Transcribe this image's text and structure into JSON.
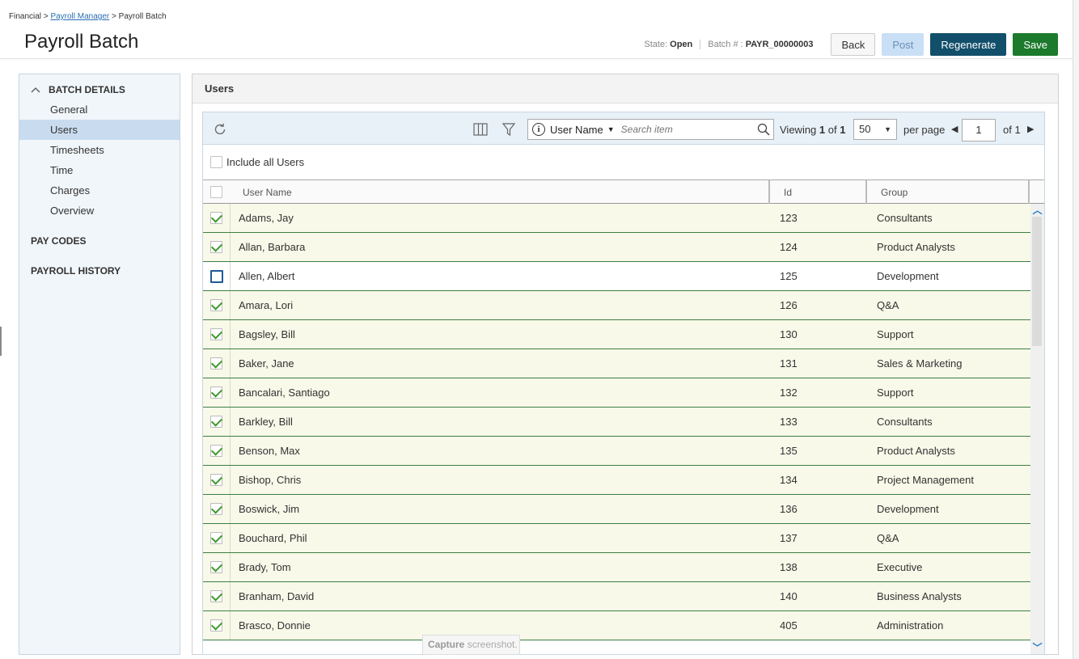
{
  "breadcrumb": {
    "root": "Financial",
    "sep1": ">",
    "parent": "Payroll Manager",
    "sep2": ">",
    "current": "Payroll Batch"
  },
  "page": {
    "title": "Payroll Batch"
  },
  "header": {
    "state_label": "State:",
    "state_value": "Open",
    "batch_label": "Batch # :",
    "batch_value": "PAYR_00000003",
    "back": "Back",
    "post": "Post",
    "regenerate": "Regenerate",
    "save": "Save"
  },
  "sidebar": {
    "batch_details": "BATCH DETAILS",
    "items": [
      {
        "label": "General"
      },
      {
        "label": "Users"
      },
      {
        "label": "Timesheets"
      },
      {
        "label": "Time"
      },
      {
        "label": "Charges"
      },
      {
        "label": "Overview"
      }
    ],
    "pay_codes": "PAY CODES",
    "payroll_history": "PAYROLL HISTORY"
  },
  "panel": {
    "title": "Users"
  },
  "toolbar": {
    "search_field": "User Name",
    "search_placeholder": "Search item",
    "viewing_label": "Viewing",
    "viewing_from": "1",
    "viewing_of": "of",
    "viewing_total": "1",
    "per_page_value": "50",
    "per_page_label": "per page",
    "page_value": "1",
    "page_of": "of 1"
  },
  "include_all": "Include all Users",
  "columns": {
    "user": "User Name",
    "id": "Id",
    "group": "Group"
  },
  "users": [
    {
      "name": "Adams, Jay",
      "id": "123",
      "group": "Consultants",
      "checked": true
    },
    {
      "name": "Allan, Barbara",
      "id": "124",
      "group": "Product Analysts",
      "checked": true
    },
    {
      "name": "Allen, Albert",
      "id": "125",
      "group": "Development",
      "checked": false
    },
    {
      "name": "Amara, Lori",
      "id": "126",
      "group": "Q&A",
      "checked": true
    },
    {
      "name": "Bagsley, Bill",
      "id": "130",
      "group": "Support",
      "checked": true
    },
    {
      "name": "Baker, Jane",
      "id": "131",
      "group": "Sales & Marketing",
      "checked": true
    },
    {
      "name": "Bancalari, Santiago",
      "id": "132",
      "group": "Support",
      "checked": true
    },
    {
      "name": "Barkley, Bill",
      "id": "133",
      "group": "Consultants",
      "checked": true
    },
    {
      "name": "Benson, Max",
      "id": "135",
      "group": "Product Analysts",
      "checked": true
    },
    {
      "name": "Bishop, Chris",
      "id": "134",
      "group": "Project Management",
      "checked": true
    },
    {
      "name": "Boswick, Jim",
      "id": "136",
      "group": "Development",
      "checked": true
    },
    {
      "name": "Bouchard, Phil",
      "id": "137",
      "group": "Q&A",
      "checked": true
    },
    {
      "name": "Brady, Tom",
      "id": "138",
      "group": "Executive",
      "checked": true
    },
    {
      "name": "Branham, David",
      "id": "140",
      "group": "Business Analysts",
      "checked": true
    },
    {
      "name": "Brasco, Donnie",
      "id": "405",
      "group": "Administration",
      "checked": true
    }
  ],
  "tooltip": {
    "bold": "Capture",
    "rest": "screenshot."
  },
  "icons": {
    "refresh": "refresh-icon",
    "columns": "columns-icon",
    "filter": "filter-icon",
    "info": "info-icon",
    "search": "search-icon",
    "collapse": "chevron-up-icon"
  },
  "colors": {
    "regenerate": "#124f6b",
    "save": "#1c7a2c",
    "post": "#c9dff5",
    "row_selected": "#f8f9e9",
    "check": "#3b9a2a"
  }
}
